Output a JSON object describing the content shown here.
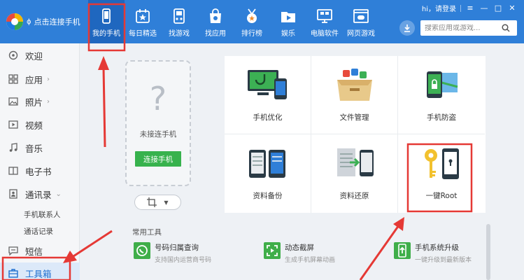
{
  "header": {
    "brand": "点击连接手机",
    "tabs": [
      {
        "label": "我的手机",
        "icon": "phone-icon"
      },
      {
        "label": "每日精选",
        "icon": "calendar-star-icon"
      },
      {
        "label": "找游戏",
        "icon": "gamepad-icon"
      },
      {
        "label": "找应用",
        "icon": "shopping-bag-icon"
      },
      {
        "label": "排行榜",
        "icon": "medal-icon"
      },
      {
        "label": "娱乐",
        "icon": "folder-play-icon"
      },
      {
        "label": "电脑软件",
        "icon": "monitor-icon"
      },
      {
        "label": "网页游戏",
        "icon": "web-game-icon"
      }
    ],
    "login": "hi，请登录",
    "search_placeholder": "搜索应用或游戏..."
  },
  "sidebar": {
    "items": [
      {
        "label": "欢迎"
      },
      {
        "label": "应用"
      },
      {
        "label": "照片"
      },
      {
        "label": "视频"
      },
      {
        "label": "音乐"
      },
      {
        "label": "电子书"
      },
      {
        "label": "通讯录"
      },
      {
        "label": "短信"
      },
      {
        "label": "工具箱"
      }
    ],
    "sub_items": [
      "手机联系人",
      "通话记录"
    ]
  },
  "phone_panel": {
    "placeholder_icon": "?",
    "status": "未接连手机",
    "connect_label": "连接手机"
  },
  "tools": [
    {
      "label": "手机优化",
      "icon": "phone-stethoscope-icon"
    },
    {
      "label": "文件管理",
      "icon": "file-box-icon"
    },
    {
      "label": "手机防盗",
      "icon": "phone-lock-map-icon"
    },
    {
      "label": "资料备份",
      "icon": "backup-icon"
    },
    {
      "label": "资料还原",
      "icon": "restore-icon"
    },
    {
      "label": "一键Root",
      "icon": "root-key-icon"
    }
  ],
  "common_tools": {
    "title": "常用工具",
    "items": [
      {
        "title": "号码归属查询",
        "desc": "支持国内运营商号码",
        "icon": "phone-query-icon",
        "color": "#3fae49"
      },
      {
        "title": "动态截屏",
        "desc": "生成手机屏幕动画",
        "icon": "screen-capture-icon",
        "color": "#3fae49"
      },
      {
        "title": "手机系统升级",
        "desc": "一键升级到最新版本",
        "icon": "system-upgrade-icon",
        "color": "#3fae49"
      }
    ]
  },
  "colors": {
    "topbar": "#2f7fd8",
    "active_tab": "#1f67bf",
    "accent_green": "#37b24d",
    "annotation_red": "#e53935"
  }
}
